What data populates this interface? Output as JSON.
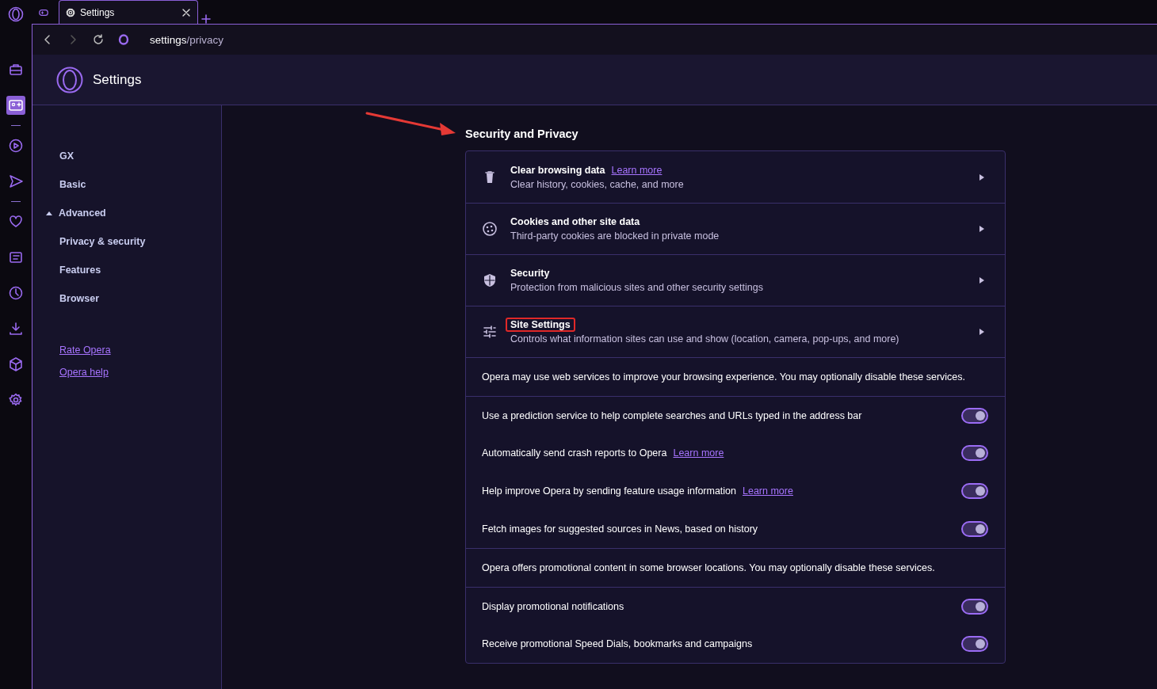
{
  "rail": {
    "items": [
      {
        "selected": false
      },
      {
        "selected": true
      },
      {
        "selected": false
      },
      {
        "selected": false
      },
      {
        "selected": false
      },
      {
        "selected": false
      },
      {
        "selected": false
      },
      {
        "selected": false
      },
      {
        "selected": false
      },
      {
        "selected": false
      }
    ]
  },
  "tabs": [
    {
      "kind": "icon",
      "selected": false
    },
    {
      "kind": "page",
      "label": "Settings",
      "selected": true
    }
  ],
  "address": {
    "host": "settings",
    "path": "/privacy"
  },
  "header": {
    "title": "Settings"
  },
  "sidebar": {
    "items": [
      {
        "label": "GX"
      },
      {
        "label": "Basic"
      },
      {
        "label": "Advanced",
        "expanded": true,
        "children": [
          {
            "label": "Privacy & security"
          },
          {
            "label": "Features"
          },
          {
            "label": "Browser"
          }
        ]
      }
    ],
    "links": [
      "Rate Opera",
      "Opera help"
    ]
  },
  "section": {
    "title": "Security and Privacy",
    "arrow_annotation": true,
    "rows": [
      {
        "kind": "nav",
        "title": "Clear browsing data",
        "link": "Learn more",
        "subtitle": "Clear history, cookies, cache, and more",
        "highlighted": false
      },
      {
        "kind": "nav",
        "title": "Cookies and other site data",
        "subtitle": "Third-party cookies are blocked in private mode",
        "highlighted": false
      },
      {
        "kind": "nav",
        "title": "Security",
        "subtitle": "Protection from malicious sites and other security settings",
        "highlighted": false
      },
      {
        "kind": "nav",
        "title": "Site Settings",
        "subtitle": "Controls what information sites can use and show (location, camera, pop-ups, and more)",
        "highlighted": true
      },
      {
        "kind": "note",
        "text": "Opera may use web services to improve your browsing experience. You may optionally disable these services."
      },
      {
        "kind": "toggle",
        "label": "Use a prediction service to help complete searches and URLs typed in the address bar",
        "on": true
      },
      {
        "kind": "toggle",
        "label": "Automatically send crash reports to Opera",
        "link": "Learn more",
        "on": true
      },
      {
        "kind": "toggle",
        "label": "Help improve Opera by sending feature usage information",
        "link": "Learn more",
        "on": true
      },
      {
        "kind": "toggle",
        "label": "Fetch images for suggested sources in News, based on history",
        "on": true
      },
      {
        "kind": "note",
        "text": "Opera offers promotional content in some browser locations. You may optionally disable these services."
      },
      {
        "kind": "toggle",
        "label": "Display promotional notifications",
        "on": true
      },
      {
        "kind": "toggle",
        "label": "Receive promotional Speed Dials, bookmarks and campaigns",
        "on": true
      }
    ]
  }
}
